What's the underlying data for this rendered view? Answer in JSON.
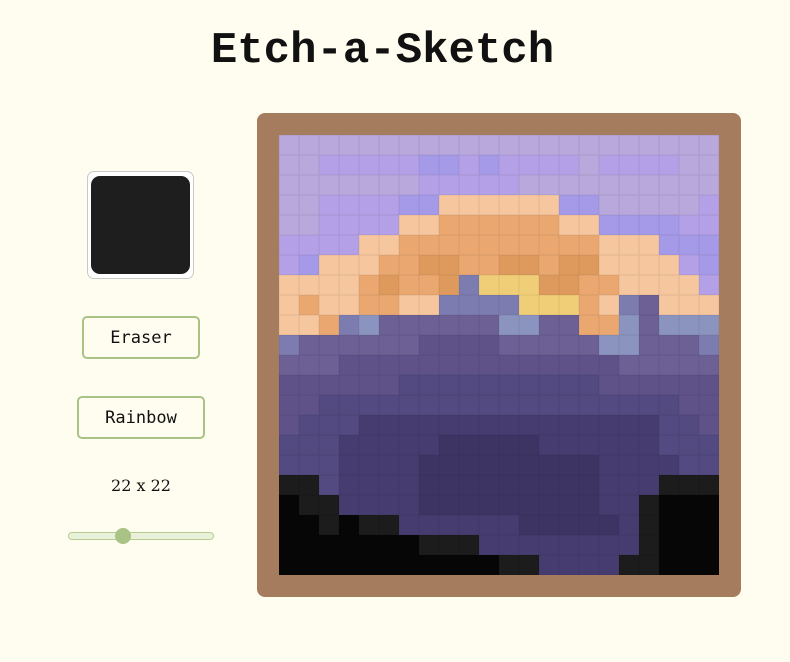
{
  "title": "Etch-a-Sketch",
  "color_picker": {
    "value": "#1e1e1e"
  },
  "buttons": {
    "eraser": "Eraser",
    "rainbow": "Rainbow"
  },
  "grid": {
    "size_label": "22 x 22",
    "size": 22,
    "slider_fraction": 0.36,
    "palette": {
      "A": "#b8a8dc",
      "B": "#b4a0e6",
      "C": "#a49ae8",
      "P": "#f6c69e",
      "O": "#eaa870",
      "R": "#de9a5c",
      "Y": "#f0ce78",
      "S": "#7c7cb0",
      "G": "#8a94be",
      "M": "#6c6094",
      "N": "#5e5288",
      "Q": "#524a80",
      "D": "#463c70",
      "E": "#3e3464",
      "K": "#1c1c1c",
      "X": "#060606"
    },
    "rows": [
      "AAAAAAAAAAAAAAAAAAAAAA",
      "AABBBBBCCBCBBBBABBBBAA",
      "AAAAAAABBBBBAAAAAAAAAA",
      "AABBBBCCPPPPPPCCAAAAAB",
      "AABBBBPPOOOOOOPPCCCCBB",
      "BBBBPPOOOOOOOOOOPPPCCC",
      "BCPPPOORROORRORRPPPPBC",
      "PPPPOROORSYYYRROOPPPPB",
      "POPPOOPPSSSSYYYOPSMPPP",
      "PPOSGMMMMMMGGMMOOGMGGG",
      "SMMMMMMNNNNMMMMMGGMMMS",
      "MMMNNNNNNNNNNNNNNMMMMM",
      "NNNNNNQQQQQQQQQQNNNNNN",
      "NNQQQQQQQQQQQQQQQQQQNN",
      "NQQQDDDDDDDDDDDDDDDQQN",
      "QQQDDDDDEEEEEDDDDDDQQQ",
      "QQQDDDDEEEEEEEEEDDDDQQ",
      "KKQDDDDEEEEEEEEEDDDKKK",
      "XKKDDDDEEEEEEEEEDDKXXX",
      "XXKXKKDDDDDDEEEEEDKXXX",
      "XXXXXXXKKKDDDDDDDDKXXX",
      "XXXXXXXXXXXKKDDDDKKXXX"
    ]
  }
}
